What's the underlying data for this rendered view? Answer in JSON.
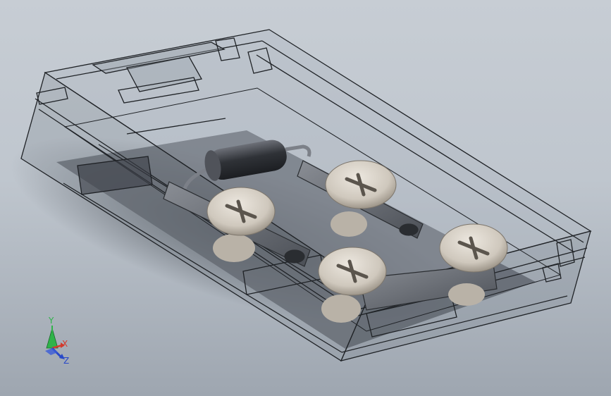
{
  "viewport": {
    "type": "cad-3d-viewport",
    "background_colors": [
      "#c7cdd4",
      "#9ea6b0"
    ],
    "model": {
      "description_icon": "transparent-enclosure-assembly",
      "parts": [
        "enclosure-housing",
        "cylindrical-component",
        "screw-terminal",
        "metal-bracket"
      ]
    }
  },
  "triad": {
    "y_label": "Y",
    "x_label": "X",
    "z_label": "Z",
    "colors": {
      "y": "#2fb34a",
      "x": "#d33a2c",
      "z": "#2848c8"
    }
  }
}
